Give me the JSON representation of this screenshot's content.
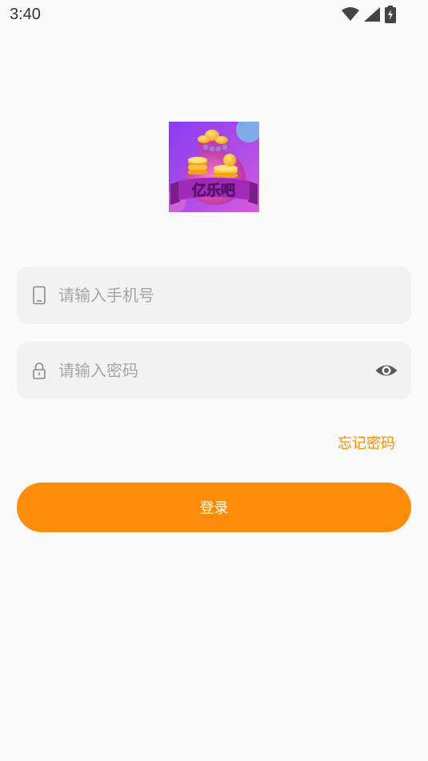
{
  "status_bar": {
    "time": "3:40"
  },
  "app_logo": {
    "text": "亿乐吧"
  },
  "login_form": {
    "phone_placeholder": "请输入手机号",
    "phone_value": "",
    "password_placeholder": "请输入密码",
    "password_value": "",
    "forgot_password_label": "忘记密码",
    "login_label": "登录"
  },
  "colors": {
    "accent": "#ff8c0a",
    "background": "#fafafa",
    "field_background": "#f2f2f2",
    "placeholder": "#a6a6a6"
  },
  "icons": {
    "phone_field": "phone-icon",
    "password_field": "lock-icon",
    "show_password": "eye-icon"
  }
}
